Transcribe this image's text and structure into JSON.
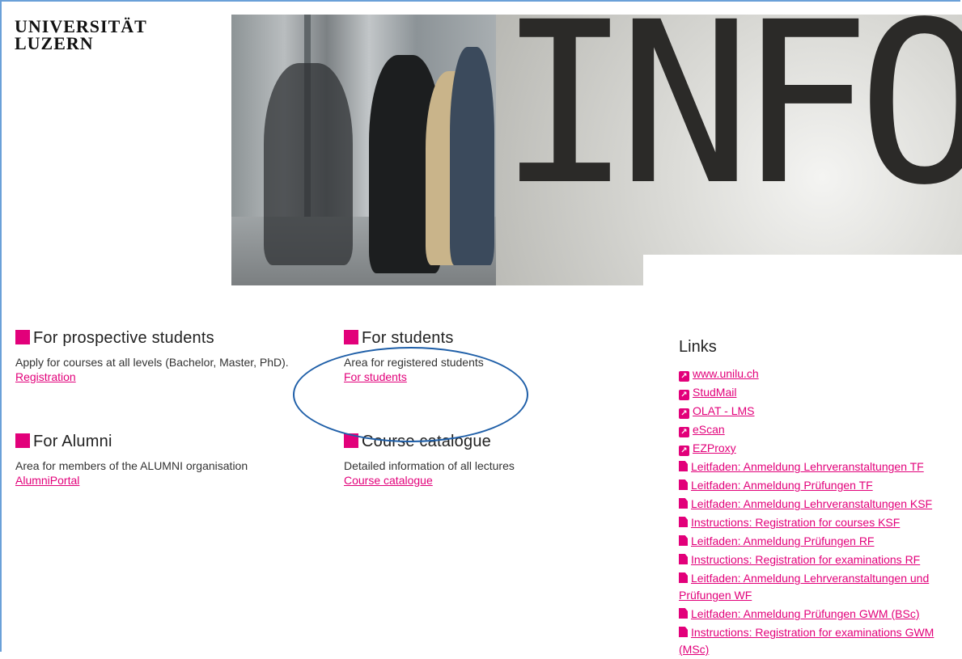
{
  "logo": {
    "line1": "UNIVERSITÄT",
    "line2": "LUZERN"
  },
  "hero": {
    "text": "INFO"
  },
  "sections": {
    "prospective": {
      "title": "For prospective students",
      "text": "Apply for courses at all levels (Bachelor, Master, PhD).",
      "link": "Registration"
    },
    "students": {
      "title": "For students",
      "text": "Area for registered students",
      "link": "For students"
    },
    "alumni": {
      "title": "For Alumni",
      "text": "Area for members of the ALUMNI organisation",
      "link": "AlumniPortal"
    },
    "course": {
      "title": "Course catalogue",
      "text": "Detailed information of all lectures",
      "link": "Course catalogue"
    }
  },
  "links": {
    "title": "Links",
    "items": [
      {
        "label": "www.unilu.ch",
        "icon": "external-link-icon"
      },
      {
        "label": "StudMail",
        "icon": "external-link-icon"
      },
      {
        "label": "OLAT - LMS",
        "icon": "external-link-icon"
      },
      {
        "label": "eScan",
        "icon": "external-link-icon"
      },
      {
        "label": "EZProxy",
        "icon": "external-link-icon"
      },
      {
        "label": "Leitfaden: Anmeldung Lehrveranstaltungen TF",
        "icon": "pdf-icon"
      },
      {
        "label": "Leitfaden: Anmeldung Prüfungen TF",
        "icon": "pdf-icon"
      },
      {
        "label": "Leitfaden: Anmeldung Lehrveranstaltungen KSF",
        "icon": "pdf-icon"
      },
      {
        "label": "Instructions: Registration for courses KSF",
        "icon": "pdf-icon"
      },
      {
        "label": "Leitfaden: Anmeldung Prüfungen RF",
        "icon": "pdf-icon"
      },
      {
        "label": "Instructions: Registration for examinations RF",
        "icon": "pdf-icon"
      },
      {
        "label": "Leitfaden: Anmeldung Lehrveranstaltungen und Prüfungen WF",
        "icon": "pdf-icon"
      },
      {
        "label": "Leitfaden: Anmeldung Prüfungen GWM (BSc)",
        "icon": "pdf-icon"
      },
      {
        "label": "Instructions: Registration for examinations GWM (MSc)",
        "icon": "pdf-icon"
      }
    ]
  },
  "colors": {
    "accent": "#e2007a",
    "annotation": "#1f5fa8",
    "frame": "#6aa0d8"
  }
}
